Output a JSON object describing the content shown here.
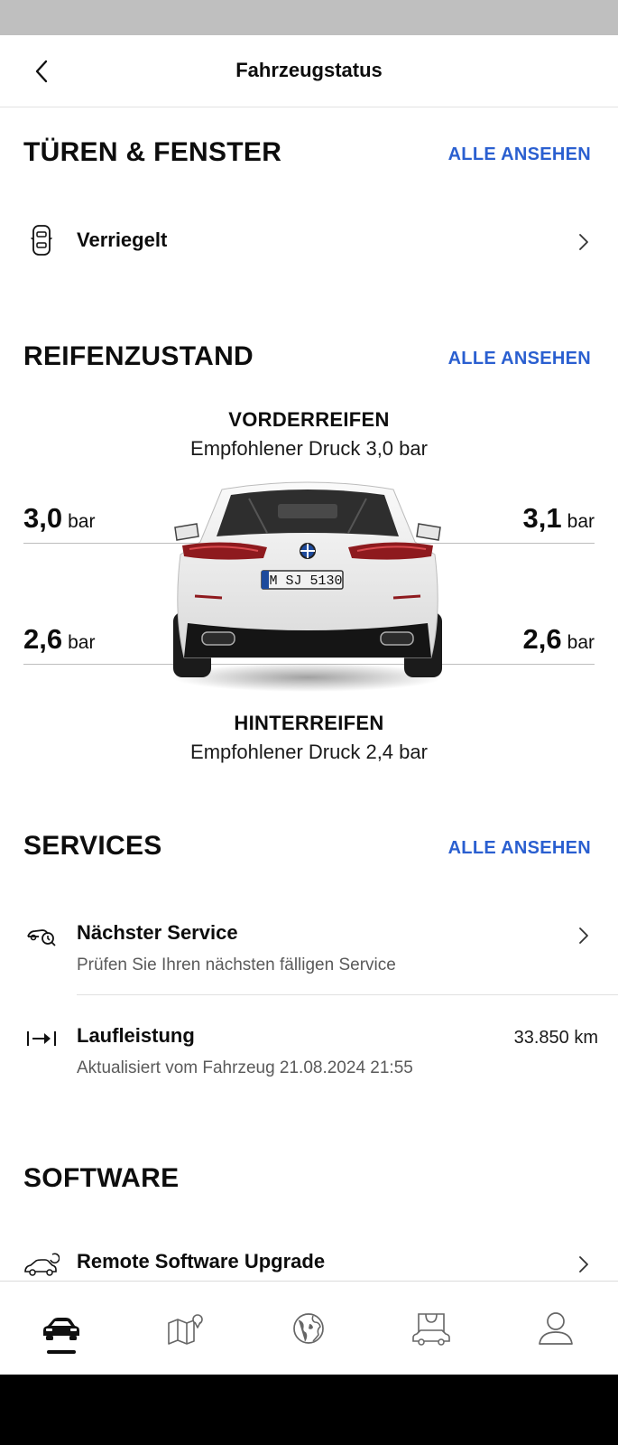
{
  "header": {
    "title": "Fahrzeugstatus"
  },
  "doors": {
    "title": "TÜREN & FENSTER",
    "see_all": "ALLE ANSEHEN",
    "status": "Verriegelt"
  },
  "tires": {
    "title": "REIFENZUSTAND",
    "see_all": "ALLE ANSEHEN",
    "front_heading": "VORDERREIFEN",
    "front_recommended": "Empfohlener Druck 3,0 bar",
    "rear_heading": "HINTERREIFEN",
    "rear_recommended": "Empfohlener Druck 2,4 bar",
    "unit": "bar",
    "front_left": "3,0",
    "front_right": "3,1",
    "rear_left": "2,6",
    "rear_right": "2,6",
    "plate": "M SJ 5130"
  },
  "services": {
    "title": "SERVICES",
    "see_all": "ALLE ANSEHEN",
    "next_service_title": "Nächster Service",
    "next_service_sub": "Prüfen Sie Ihren nächsten fälligen Service",
    "mileage_title": "Laufleistung",
    "mileage_sub": "Aktualisiert vom Fahrzeug 21.08.2024 21:55",
    "mileage_value": "33.850 km"
  },
  "software": {
    "title": "SOFTWARE",
    "upgrade_title": "Remote Software Upgrade"
  },
  "nav": {
    "items": [
      "car-icon",
      "map-pin-icon",
      "globe-icon",
      "shopping-bag-icon",
      "profile-icon"
    ],
    "active": 0
  }
}
